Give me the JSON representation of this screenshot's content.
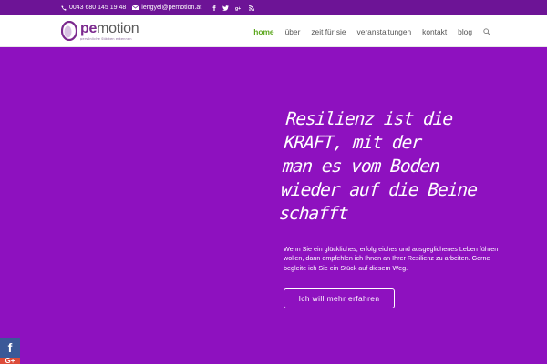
{
  "topbar": {
    "phone": "0043 680 145 19 48",
    "email": "lengyel@pemotion.at",
    "social_icons": [
      "facebook-icon",
      "twitter-icon",
      "google-plus-icon",
      "rss-icon"
    ]
  },
  "header": {
    "logo": {
      "main_prefix": "pe",
      "main_suffix": "motion",
      "tagline": "persönliche Stärken erkennen"
    },
    "nav": [
      {
        "label": "home",
        "active": true
      },
      {
        "label": "über",
        "active": false
      },
      {
        "label": "zeit für sie",
        "active": false
      },
      {
        "label": "veranstaltungen",
        "active": false
      },
      {
        "label": "kontakt",
        "active": false
      },
      {
        "label": "blog",
        "active": false
      }
    ]
  },
  "hero": {
    "title_lines": [
      "Resilienz ist die",
      "KRAFT, mit der",
      "man es vom Boden",
      "wieder auf die Beine",
      "schafft"
    ],
    "text": "Wenn Sie ein glückliches, erfolgreiches und ausgeglichenes Leben führen wollen, dann empfehlen ich Ihnen an Ihrer Resilienz zu arbeiten. Gerne begleite ich Sie ein Stück auf diesem Weg.",
    "button_label": "Ich will mehr erfahren"
  },
  "share": {
    "facebook_glyph": "f",
    "google_glyph": "G+"
  },
  "colors": {
    "hero_bg": "#8e11bf",
    "topbar_bg": "#6d1496",
    "nav_active": "#5aa61b",
    "facebook": "#3b5998",
    "google": "#dd4b39"
  }
}
